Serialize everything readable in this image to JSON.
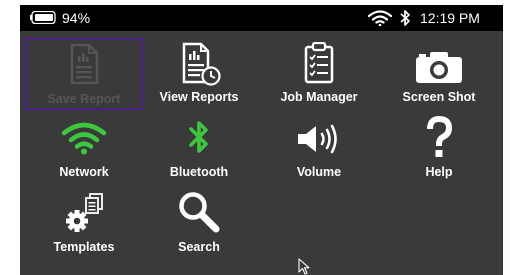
{
  "status": {
    "battery_percent": "94%",
    "time": "12:19 PM",
    "battery_icon": "battery-icon",
    "wifi_icon": "wifi-icon",
    "bluetooth_icon": "bluetooth-icon"
  },
  "menu": {
    "items": [
      {
        "label": "Save Report",
        "icon": "save-report-icon",
        "state": "disabled-selected"
      },
      {
        "label": "View Reports",
        "icon": "view-reports-icon"
      },
      {
        "label": "Job Manager",
        "icon": "clipboard-icon"
      },
      {
        "label": "Screen Shot",
        "icon": "camera-icon"
      },
      {
        "label": "Network",
        "icon": "wifi-icon",
        "color": "#3cc83c"
      },
      {
        "label": "Bluetooth",
        "icon": "bluetooth-icon",
        "color": "#3cc83c"
      },
      {
        "label": "Volume",
        "icon": "speaker-icon"
      },
      {
        "label": "Help",
        "icon": "question-icon"
      },
      {
        "label": "Templates",
        "icon": "templates-icon"
      },
      {
        "label": "Search",
        "icon": "magnifier-icon"
      }
    ]
  },
  "colors": {
    "background": "#3a3a3a",
    "statusbar": "#000000",
    "accent_green": "#3cc83c",
    "selection_border": "#4a1f8a",
    "disabled": "#555555"
  }
}
